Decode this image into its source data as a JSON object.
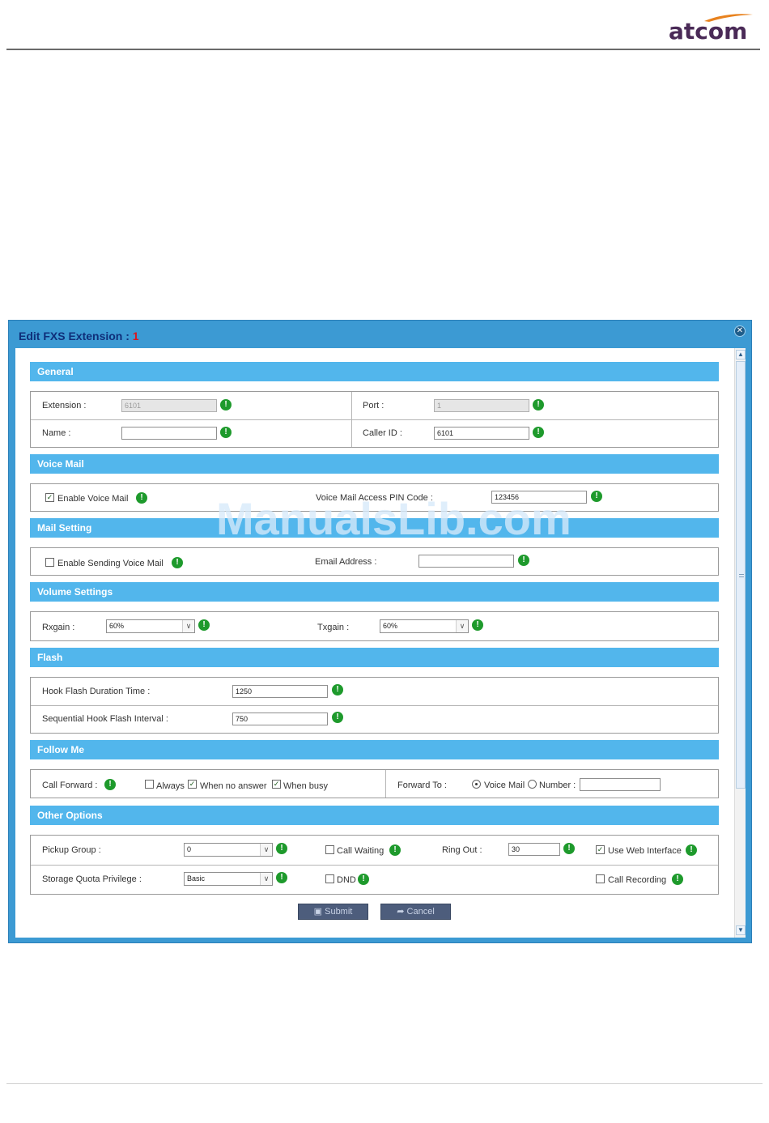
{
  "page": {
    "logo_text": "atcom",
    "watermark": "ManualsLib.com"
  },
  "dialog": {
    "title": "Edit FXS Extension : ",
    "extension_number": "1",
    "close_icon": "close-icon"
  },
  "sections": {
    "general": "General",
    "voice_mail": "Voice Mail",
    "mail_setting": "Mail Setting",
    "volume_settings": "Volume  Settings",
    "flash": "Flash",
    "follow_me": "Follow Me",
    "other_options": "Other Options"
  },
  "general": {
    "extension_label": "Extension :",
    "extension_value": "6101",
    "port_label": "Port :",
    "port_value": "1",
    "name_label": "Name :",
    "name_value": "",
    "callerid_label": "Caller ID :",
    "callerid_value": "6101"
  },
  "voice_mail": {
    "enable_label": "Enable Voice Mail",
    "enable_checked": true,
    "pin_label": "Voice Mail Access PIN Code :",
    "pin_value": "123456"
  },
  "mail_setting": {
    "enable_sending_label": "Enable Sending Voice Mail",
    "enable_sending_checked": false,
    "email_label": "Email Address :",
    "email_value": ""
  },
  "volume": {
    "rxgain_label": "Rxgain :",
    "rxgain_value": "60%",
    "txgain_label": "Txgain :",
    "txgain_value": "60%"
  },
  "flash": {
    "duration_label": "Hook Flash Duration Time :",
    "duration_value": "1250",
    "interval_label": "Sequential Hook Flash Interval :",
    "interval_value": "750"
  },
  "follow_me": {
    "call_forward_label": "Call Forward :",
    "always_label": "Always",
    "always_checked": false,
    "no_answer_label": "When no answer",
    "no_answer_checked": true,
    "busy_label": "When busy",
    "busy_checked": true,
    "forward_to_label": "Forward To :",
    "voicemail_option": "Voice Mail",
    "voicemail_selected": true,
    "number_option": "Number :",
    "number_value": ""
  },
  "other_options": {
    "pickup_label": "Pickup Group :",
    "pickup_value": "0",
    "call_waiting_label": "Call Waiting",
    "call_waiting_checked": false,
    "ring_out_label": "Ring Out :",
    "ring_out_value": "30",
    "web_interface_label": "Use Web Interface",
    "web_interface_checked": true,
    "storage_label": "Storage Quota Privilege :",
    "storage_value": "Basic",
    "dnd_label": "DND",
    "dnd_checked": false,
    "call_recording_label": "Call Recording",
    "call_recording_checked": false
  },
  "buttons": {
    "submit_label": "Submit",
    "cancel_label": "Cancel",
    "submit_icon": "save-icon",
    "cancel_icon": "undo-arrow-icon"
  },
  "colors": {
    "dialog_frame": "#3c9ad3",
    "section_header": "#52b6ec",
    "info_icon": "#1e9a2c",
    "title_text": "#0f2f7a",
    "extension_number": "#d8191f",
    "logo_text": "#4a2a57",
    "logo_swoosh": "#e8821e"
  }
}
